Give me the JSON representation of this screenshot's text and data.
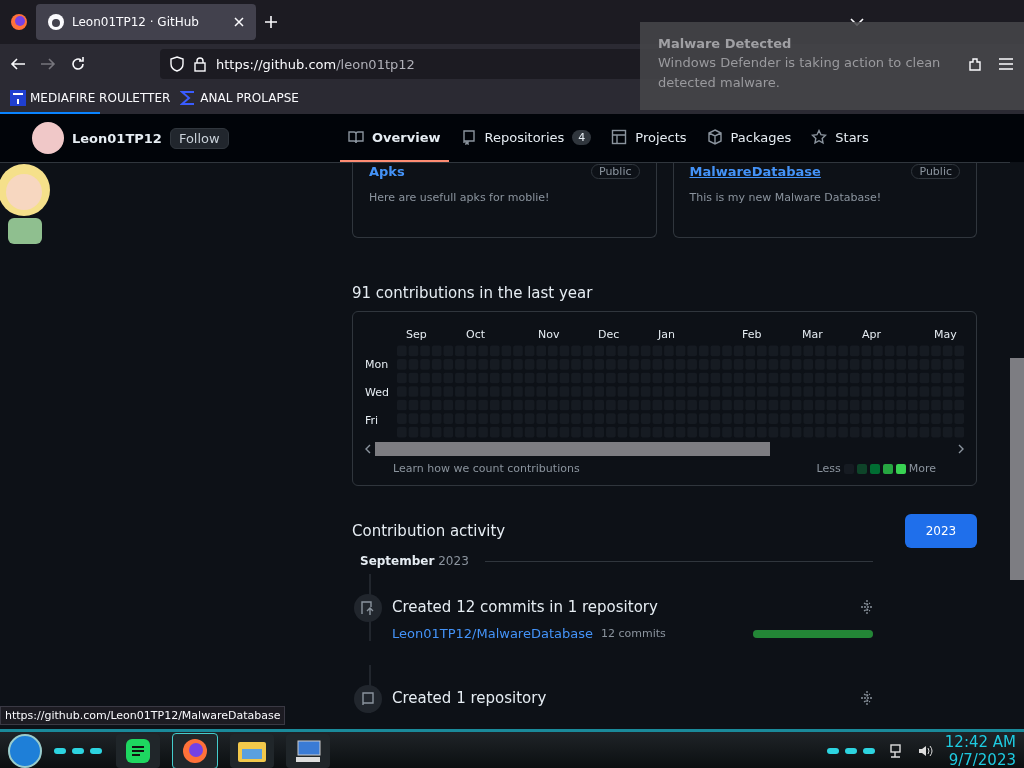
{
  "browser": {
    "tab_title": "Leon01TP12 · GitHub",
    "url_host": "https://github.com",
    "url_path": "/leon01tp12",
    "bookmarks": [
      {
        "label": "MEDIAFIRE ROULETTER",
        "kind": "mft"
      },
      {
        "label": "ANAL PROLAPSE",
        "kind": "sigma"
      }
    ]
  },
  "notification": {
    "title": "Malware Detected",
    "body": "Windows Defender is taking action to clean detected malware."
  },
  "profile": {
    "username": "Leon01TP12",
    "follow": "Follow"
  },
  "tabs": [
    {
      "label": "Overview",
      "kind": "book",
      "selected": true
    },
    {
      "label": "Repositories",
      "kind": "repo",
      "count": "4",
      "selected": false
    },
    {
      "label": "Projects",
      "kind": "table",
      "selected": false
    },
    {
      "label": "Packages",
      "kind": "package",
      "selected": false
    },
    {
      "label": "Stars",
      "kind": "star",
      "selected": false
    }
  ],
  "repos": [
    {
      "name": "Apks",
      "visibility": "Public",
      "description": "Here are usefull apks for moblie!",
      "underlined": false
    },
    {
      "name": "MalwareDatabase",
      "visibility": "Public",
      "description": "This is my new Malware Database!",
      "underlined": true
    }
  ],
  "contributions": {
    "title": "91 contributions in the last year",
    "months": [
      "Sep",
      "Oct",
      "Nov",
      "Dec",
      "Jan",
      "Feb",
      "Mar",
      "Apr",
      "May"
    ],
    "days": [
      "Mon",
      "Wed",
      "Fri"
    ],
    "learn": "Learn how we count contributions",
    "less": "Less",
    "more": "More"
  },
  "activity": {
    "title": "Contribution activity",
    "years": [
      {
        "label": "2023",
        "selected": true
      }
    ],
    "month": "September",
    "month_year": "2023",
    "items": [
      {
        "kind": "commits",
        "title": "Created 12 commits in 1 repository",
        "repo": "Leon01TP12/MalwareDatabase",
        "count": "12 commits",
        "level": 1
      },
      {
        "kind": "repository",
        "title": "Created 1 repository"
      }
    ]
  },
  "status_url": "https://github.com/Leon01TP12/MalwareDatabase",
  "clock": {
    "time": "12:42 AM",
    "date": "9/7/2023"
  }
}
